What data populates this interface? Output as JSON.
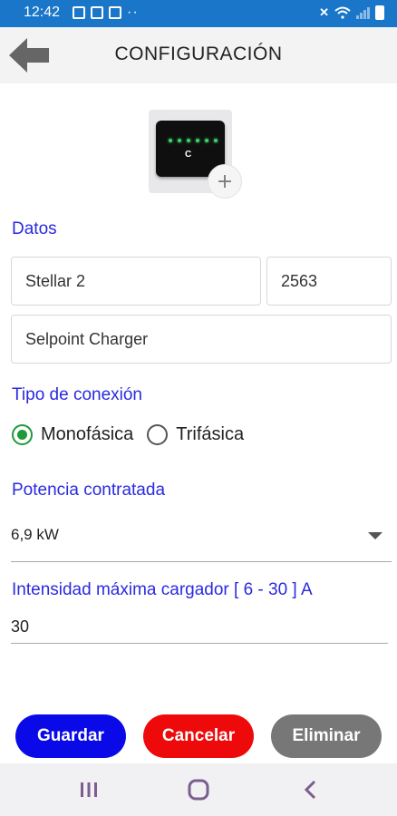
{
  "status_bar": {
    "time": "12:42"
  },
  "header": {
    "title": "CONFIGURACIÓN"
  },
  "device_photo": {
    "logo_text": "C"
  },
  "datos": {
    "label": "Datos",
    "name_value": "Stellar 2",
    "code_value": "2563",
    "model_value": "Selpoint Charger"
  },
  "conexion": {
    "label": "Tipo de conexión",
    "options": [
      {
        "label": "Monofásica",
        "selected": true
      },
      {
        "label": "Trifásica",
        "selected": false
      }
    ]
  },
  "potencia": {
    "label": "Potencia contratada",
    "selected_value": "6,9 kW"
  },
  "intensidad": {
    "label": "Intensidad máxima cargador [ 6 - 30 ] A",
    "value": "30"
  },
  "buttons": {
    "save": "Guardar",
    "cancel": "Cancelar",
    "delete": "Eliminar"
  },
  "colors": {
    "accent_label": "#2a2ae0",
    "save": "#0a0ae8",
    "cancel": "#ee0a0a",
    "delete": "#777777",
    "radio_selected": "#1f9a3a",
    "status_bar": "#1976c9"
  },
  "icons": {
    "back": "arrow-left-icon",
    "add_photo": "plus-icon",
    "nav_recents": "recents-icon",
    "nav_home": "home-icon",
    "nav_back": "chevron-left-icon"
  }
}
